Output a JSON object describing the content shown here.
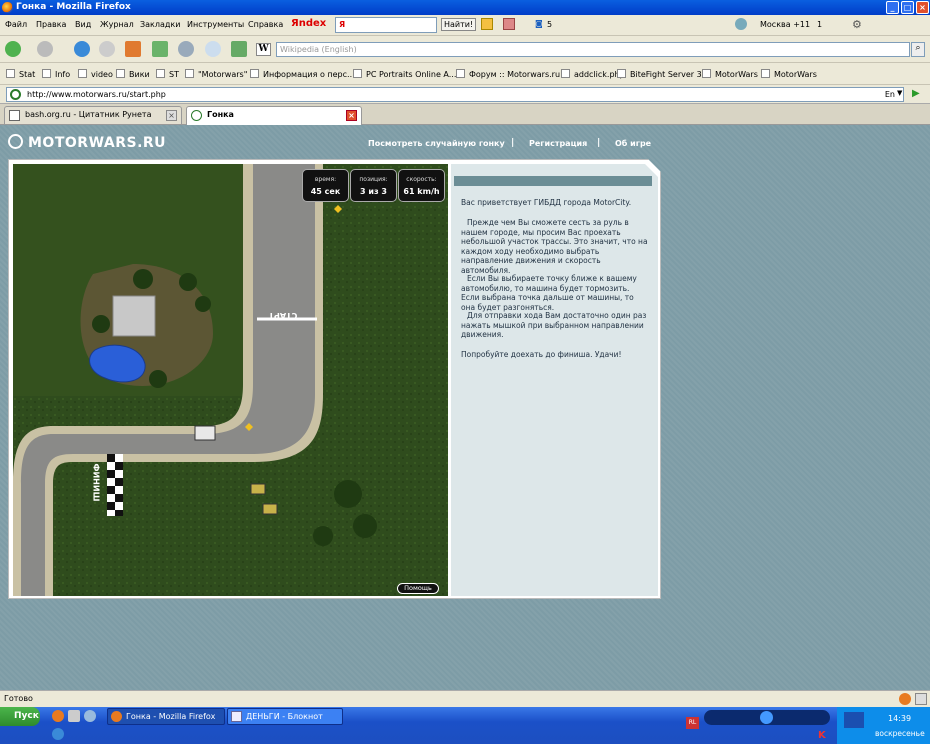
{
  "window": {
    "title": "Гонка - Mozilla Firefox"
  },
  "menu": [
    "Файл",
    "Правка",
    "Вид",
    "Журнал",
    "Закладки",
    "Инструменты",
    "Справка"
  ],
  "yandex": {
    "logo": "Яndex",
    "search_label": "Я",
    "find_button": "Найти!",
    "comments_count": "5",
    "weather": "Москва +11",
    "count": "1"
  },
  "search": {
    "placeholder": "Wikipedia (English)"
  },
  "bookmarks": [
    "Stat",
    "Info",
    "video",
    "Вики",
    "ST",
    "\"Motorwars\"",
    "Информация о перс...",
    "PC Portraits Online A...",
    "Форум :: Motorwars.ru",
    "addclick.php",
    "BiteFight Server 3",
    "MotorWars",
    "MotorWars"
  ],
  "address": {
    "url": "http://www.motorwars.ru/start.php",
    "lang": "En"
  },
  "tabs": [
    {
      "label": "bash.org.ru - Цитатник Рунета"
    },
    {
      "label": "Гонка"
    }
  ],
  "site": {
    "logo": "MOTORWARS.RU",
    "nav": [
      "Посмотреть случайную гонку",
      "Регистрация",
      "Об игре"
    ],
    "nav_sep": "|"
  },
  "game": {
    "hud": [
      {
        "label": "время:",
        "value": "45 сек"
      },
      {
        "label": "позиция:",
        "value": "3 из 3"
      },
      {
        "label": "скорость:",
        "value": "61 km/h"
      }
    ],
    "start_label": "СТАРТ",
    "finish_label": "ФИНИШ",
    "help_button": "Помощь"
  },
  "sidebar": {
    "p1": "Вас приветствует ГИБДД города MotorCity.",
    "p2": "Прежде чем Вы сможете сесть за руль в нашем городе, мы просим Вас проехать небольшой участок трассы. Это значит, что на каждом ходу необходимо выбрать направление движения и скорость автомобиля.",
    "p3": "Если Вы выбираете точку ближе к вашему автомобилю, то машина будет тормозить. Если выбрана точка дальше от машины, то она будет разгоняться.",
    "p4": "Для отправки хода Вам достаточно один раз нажать мышкой при выбранном направлении движения.",
    "p5": "Попробуйте доехать до финиша. Удачи!"
  },
  "status": {
    "text": "Готово"
  },
  "taskbar": {
    "start": "Пуск",
    "tasks": [
      "Гонка - Mozilla Firefox",
      "ДЕНЬГИ - Блокнот"
    ],
    "lang": "RL",
    "time": "14:39",
    "day": "воскресенье"
  }
}
